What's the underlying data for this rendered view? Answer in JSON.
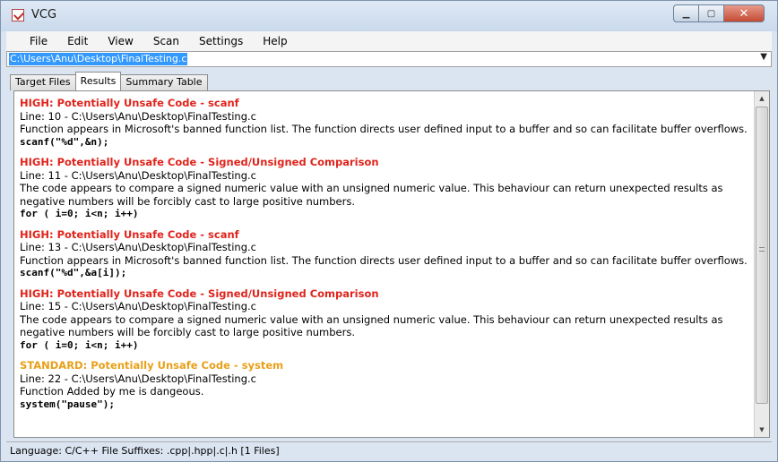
{
  "window": {
    "title": "VCG",
    "minimize_icon": "minimize-icon",
    "maximize_icon": "maximize-icon",
    "close_icon": "close-icon",
    "minimize_glyph": "▁",
    "maximize_glyph": "▢",
    "close_glyph": "✕"
  },
  "menu": [
    "File",
    "Edit",
    "View",
    "Scan",
    "Settings",
    "Help"
  ],
  "path_combo": {
    "value": "C:\\Users\\Anu\\Desktop\\FinalTesting.c",
    "arrow": "▼"
  },
  "tabs": [
    {
      "label": "Target Files",
      "active": false
    },
    {
      "label": "Results",
      "active": true
    },
    {
      "label": "Summary Table",
      "active": false
    }
  ],
  "findings": [
    {
      "severity": "high",
      "heading": "HIGH: Potentially Unsafe Code - scanf",
      "location": "Line: 10 - C:\\Users\\Anu\\Desktop\\FinalTesting.c",
      "description": "Function appears in Microsoft's banned function list. The function directs user defined input to a buffer and so can facilitate buffer overflows.",
      "code": "scanf(\"%d\",&n);"
    },
    {
      "severity": "high",
      "heading": "HIGH: Potentially Unsafe Code - Signed/Unsigned Comparison",
      "location": "Line: 11 - C:\\Users\\Anu\\Desktop\\FinalTesting.c",
      "description": "The code appears to compare a signed numeric value with an unsigned numeric value. This behaviour can return unexpected results as negative numbers will be forcibly cast to large positive numbers.",
      "code": "for ( i=0; i<n; i++)"
    },
    {
      "severity": "high",
      "heading": "HIGH: Potentially Unsafe Code - scanf",
      "location": "Line: 13 - C:\\Users\\Anu\\Desktop\\FinalTesting.c",
      "description": "Function appears in Microsoft's banned function list. The function directs user defined input to a buffer and so can facilitate buffer overflows.",
      "code": "scanf(\"%d\",&a[i]);"
    },
    {
      "severity": "high",
      "heading": "HIGH: Potentially Unsafe Code - Signed/Unsigned Comparison",
      "location": "Line: 15 - C:\\Users\\Anu\\Desktop\\FinalTesting.c",
      "description": "The code appears to compare a signed numeric value with an unsigned numeric value. This behaviour can return unexpected results as negative numbers will be forcibly cast to large positive numbers.",
      "code": "for ( i=0; i<n; i++)"
    },
    {
      "severity": "standard",
      "heading": "STANDARD: Potentially Unsafe Code - system",
      "location": "Line: 22 - C:\\Users\\Anu\\Desktop\\FinalTesting.c",
      "description": "Function Added by me is dangeous.",
      "code": "system(\"pause\");"
    }
  ],
  "scrollbar": {
    "up_glyph": "▲",
    "down_glyph": "▼"
  },
  "status": "Language: C/C++   File Suffixes: .cpp|.hpp|.c|.h   [1 Files]",
  "colors": {
    "high": "#e0241c",
    "standard": "#e8a01a",
    "selection": "#3399ff"
  }
}
